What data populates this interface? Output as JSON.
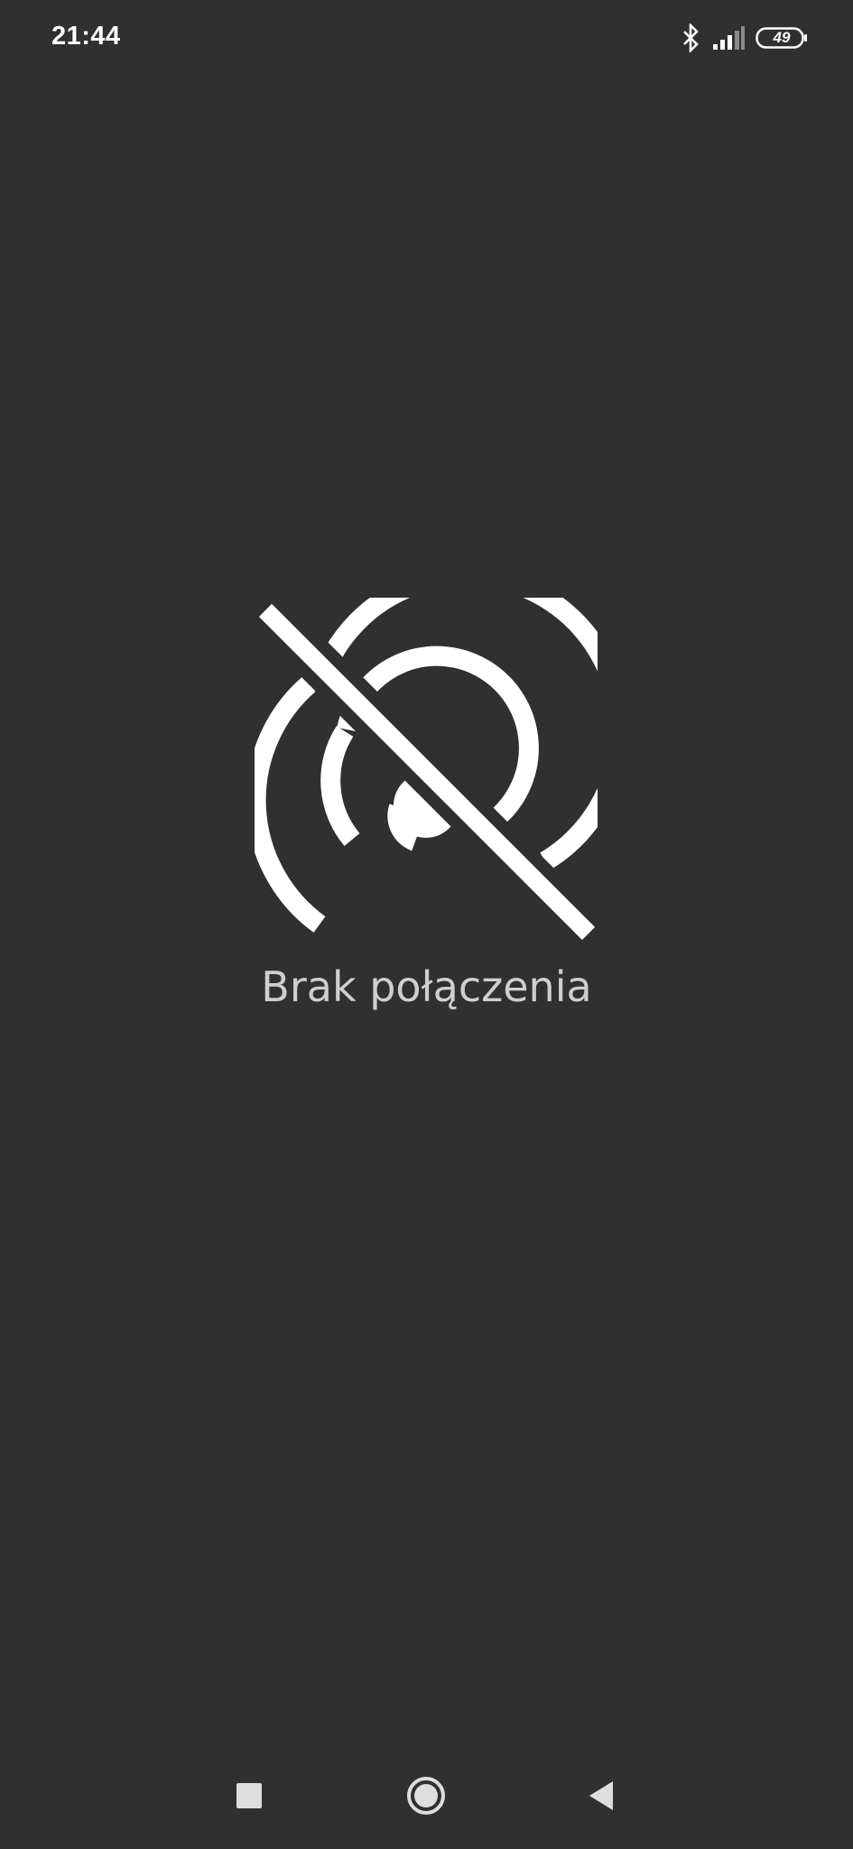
{
  "status_bar": {
    "time": "21:44",
    "icons": [
      "bluetooth-icon",
      "signal-icon",
      "battery-icon"
    ],
    "battery_level": "49"
  },
  "main": {
    "icon": "signal-off-icon",
    "message": "Brak połączenia"
  },
  "nav_bar": {
    "buttons": [
      "recents-button",
      "home-button",
      "back-button"
    ]
  },
  "colors": {
    "background": "#303030",
    "icon": "#ffffff",
    "message_text": "#cfcfcf"
  }
}
